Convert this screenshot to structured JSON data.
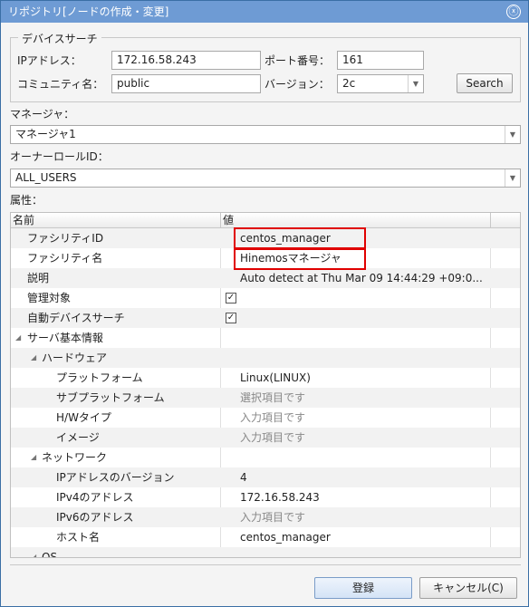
{
  "window": {
    "title": "リポジトリ[ノードの作成・変更]",
    "close_icon": "ⓧ"
  },
  "device_search": {
    "legend": "デバイスサーチ",
    "ip_label": "IPアドレス：",
    "ip_value": "172.16.58.243",
    "port_label": "ポート番号：",
    "port_value": "161",
    "community_label": "コミュニティ名：",
    "community_value": "public",
    "version_label": "バージョン：",
    "version_value": "2c",
    "search_label": "Search"
  },
  "manager": {
    "label": "マネージャ：",
    "value": "マネージャ1"
  },
  "owner_role": {
    "label": "オーナーロールID：",
    "value": "ALL_USERS"
  },
  "attributes": {
    "label": "属性：",
    "col_name": "名前",
    "col_value": "値",
    "rows": [
      {
        "name": "ファシリティID",
        "value": "centos_manager"
      },
      {
        "name": "ファシリティ名",
        "value": "Hinemosマネージャ"
      },
      {
        "name": "説明",
        "value": "Auto detect at Thu Mar 09 14:44:29 +09:0..."
      },
      {
        "name": "管理対象",
        "value": ""
      },
      {
        "name": "自動デバイスサーチ",
        "value": ""
      },
      {
        "name": "サーバ基本情報",
        "value": ""
      },
      {
        "name": "ハードウェア",
        "value": ""
      },
      {
        "name": "プラットフォーム",
        "value": "Linux(LINUX)"
      },
      {
        "name": "サブプラットフォーム",
        "value": "選択項目です"
      },
      {
        "name": "H/Wタイプ",
        "value": "入力項目です"
      },
      {
        "name": "イメージ",
        "value": "入力項目です"
      },
      {
        "name": "ネットワーク",
        "value": ""
      },
      {
        "name": "IPアドレスのバージョン",
        "value": "4"
      },
      {
        "name": "IPv4のアドレス",
        "value": "172.16.58.243"
      },
      {
        "name": "IPv6のアドレス",
        "value": "入力項目です"
      },
      {
        "name": "ホスト名",
        "value": "centos_manager"
      },
      {
        "name": "OS",
        "value": ""
      }
    ],
    "checked_mark": "✓",
    "expand_icon": "◢",
    "dropdown_icon": "▼"
  },
  "footer": {
    "register_label": "登録",
    "cancel_label": "キャンセル(C)"
  }
}
